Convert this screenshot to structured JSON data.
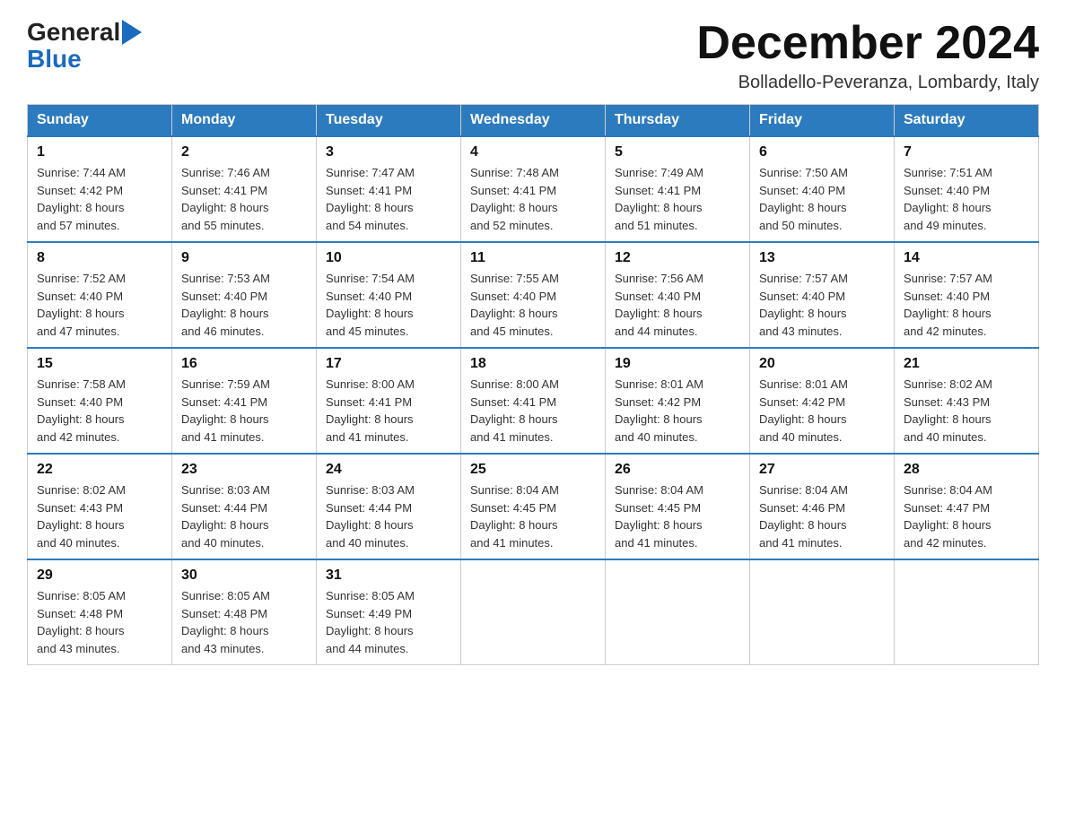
{
  "header": {
    "logo_general": "General",
    "logo_blue": "Blue",
    "month_title": "December 2024",
    "location": "Bolladello-Peveranza, Lombardy, Italy"
  },
  "days_of_week": [
    "Sunday",
    "Monday",
    "Tuesday",
    "Wednesday",
    "Thursday",
    "Friday",
    "Saturday"
  ],
  "weeks": [
    [
      {
        "day": "1",
        "sunrise": "7:44 AM",
        "sunset": "4:42 PM",
        "daylight": "8 hours and 57 minutes."
      },
      {
        "day": "2",
        "sunrise": "7:46 AM",
        "sunset": "4:41 PM",
        "daylight": "8 hours and 55 minutes."
      },
      {
        "day": "3",
        "sunrise": "7:47 AM",
        "sunset": "4:41 PM",
        "daylight": "8 hours and 54 minutes."
      },
      {
        "day": "4",
        "sunrise": "7:48 AM",
        "sunset": "4:41 PM",
        "daylight": "8 hours and 52 minutes."
      },
      {
        "day": "5",
        "sunrise": "7:49 AM",
        "sunset": "4:41 PM",
        "daylight": "8 hours and 51 minutes."
      },
      {
        "day": "6",
        "sunrise": "7:50 AM",
        "sunset": "4:40 PM",
        "daylight": "8 hours and 50 minutes."
      },
      {
        "day": "7",
        "sunrise": "7:51 AM",
        "sunset": "4:40 PM",
        "daylight": "8 hours and 49 minutes."
      }
    ],
    [
      {
        "day": "8",
        "sunrise": "7:52 AM",
        "sunset": "4:40 PM",
        "daylight": "8 hours and 47 minutes."
      },
      {
        "day": "9",
        "sunrise": "7:53 AM",
        "sunset": "4:40 PM",
        "daylight": "8 hours and 46 minutes."
      },
      {
        "day": "10",
        "sunrise": "7:54 AM",
        "sunset": "4:40 PM",
        "daylight": "8 hours and 45 minutes."
      },
      {
        "day": "11",
        "sunrise": "7:55 AM",
        "sunset": "4:40 PM",
        "daylight": "8 hours and 45 minutes."
      },
      {
        "day": "12",
        "sunrise": "7:56 AM",
        "sunset": "4:40 PM",
        "daylight": "8 hours and 44 minutes."
      },
      {
        "day": "13",
        "sunrise": "7:57 AM",
        "sunset": "4:40 PM",
        "daylight": "8 hours and 43 minutes."
      },
      {
        "day": "14",
        "sunrise": "7:57 AM",
        "sunset": "4:40 PM",
        "daylight": "8 hours and 42 minutes."
      }
    ],
    [
      {
        "day": "15",
        "sunrise": "7:58 AM",
        "sunset": "4:40 PM",
        "daylight": "8 hours and 42 minutes."
      },
      {
        "day": "16",
        "sunrise": "7:59 AM",
        "sunset": "4:41 PM",
        "daylight": "8 hours and 41 minutes."
      },
      {
        "day": "17",
        "sunrise": "8:00 AM",
        "sunset": "4:41 PM",
        "daylight": "8 hours and 41 minutes."
      },
      {
        "day": "18",
        "sunrise": "8:00 AM",
        "sunset": "4:41 PM",
        "daylight": "8 hours and 41 minutes."
      },
      {
        "day": "19",
        "sunrise": "8:01 AM",
        "sunset": "4:42 PM",
        "daylight": "8 hours and 40 minutes."
      },
      {
        "day": "20",
        "sunrise": "8:01 AM",
        "sunset": "4:42 PM",
        "daylight": "8 hours and 40 minutes."
      },
      {
        "day": "21",
        "sunrise": "8:02 AM",
        "sunset": "4:43 PM",
        "daylight": "8 hours and 40 minutes."
      }
    ],
    [
      {
        "day": "22",
        "sunrise": "8:02 AM",
        "sunset": "4:43 PM",
        "daylight": "8 hours and 40 minutes."
      },
      {
        "day": "23",
        "sunrise": "8:03 AM",
        "sunset": "4:44 PM",
        "daylight": "8 hours and 40 minutes."
      },
      {
        "day": "24",
        "sunrise": "8:03 AM",
        "sunset": "4:44 PM",
        "daylight": "8 hours and 40 minutes."
      },
      {
        "day": "25",
        "sunrise": "8:04 AM",
        "sunset": "4:45 PM",
        "daylight": "8 hours and 41 minutes."
      },
      {
        "day": "26",
        "sunrise": "8:04 AM",
        "sunset": "4:45 PM",
        "daylight": "8 hours and 41 minutes."
      },
      {
        "day": "27",
        "sunrise": "8:04 AM",
        "sunset": "4:46 PM",
        "daylight": "8 hours and 41 minutes."
      },
      {
        "day": "28",
        "sunrise": "8:04 AM",
        "sunset": "4:47 PM",
        "daylight": "8 hours and 42 minutes."
      }
    ],
    [
      {
        "day": "29",
        "sunrise": "8:05 AM",
        "sunset": "4:48 PM",
        "daylight": "8 hours and 43 minutes."
      },
      {
        "day": "30",
        "sunrise": "8:05 AM",
        "sunset": "4:48 PM",
        "daylight": "8 hours and 43 minutes."
      },
      {
        "day": "31",
        "sunrise": "8:05 AM",
        "sunset": "4:49 PM",
        "daylight": "8 hours and 44 minutes."
      },
      null,
      null,
      null,
      null
    ]
  ],
  "labels": {
    "sunrise": "Sunrise:",
    "sunset": "Sunset:",
    "daylight": "Daylight:"
  }
}
